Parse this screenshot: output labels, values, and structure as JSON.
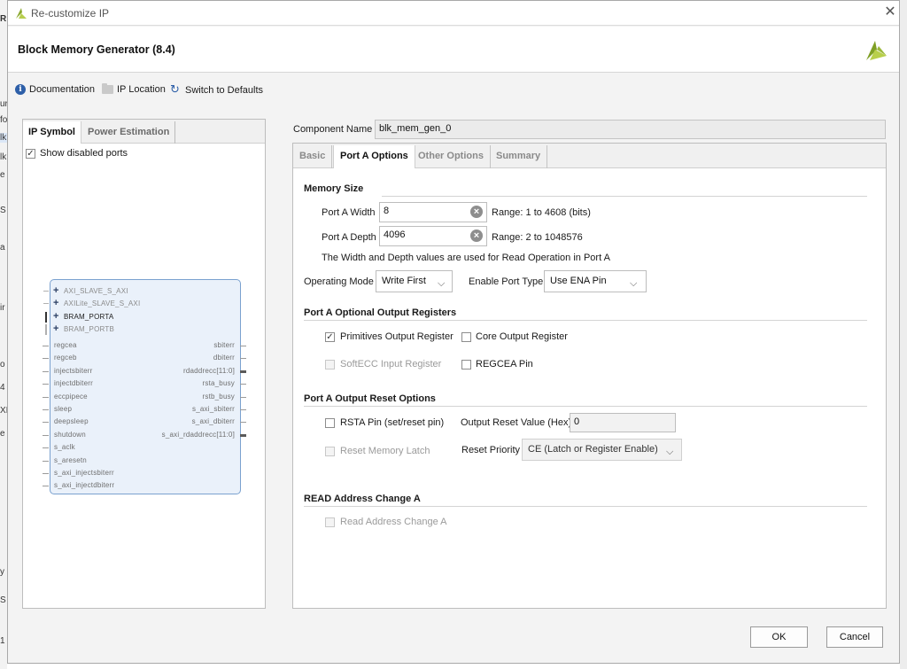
{
  "window": {
    "title": "Re-customize IP"
  },
  "header": {
    "title": "Block Memory Generator (8.4)"
  },
  "toolbar": {
    "documentation": "Documentation",
    "ip_location": "IP Location",
    "switch_defaults": "Switch to Defaults"
  },
  "left_panel": {
    "tabs": [
      "IP Symbol",
      "Power Estimation"
    ],
    "show_disabled_ports": {
      "label": "Show disabled ports",
      "checked": true
    },
    "buses": [
      "AXI_SLAVE_S_AXI",
      "AXILite_SLAVE_S_AXI",
      "BRAM_PORTA",
      "BRAM_PORTB"
    ],
    "left_ports": [
      "regcea",
      "regceb",
      "injectsbiterr",
      "injectdbiterr",
      "eccpipece",
      "sleep",
      "deepsleep",
      "shutdown",
      "s_aclk",
      "s_aresetn",
      "s_axi_injectsbiterr",
      "s_axi_injectdbiterr"
    ],
    "right_ports": [
      "sbiterr",
      "dbiterr",
      "rdaddrecc[11:0]",
      "rsta_busy",
      "rstb_busy",
      "s_axi_sbiterr",
      "s_axi_dbiterr",
      "s_axi_rdaddrecc[11:0]"
    ]
  },
  "component": {
    "label": "Component Name",
    "value": "blk_mem_gen_0"
  },
  "tabs": [
    "Basic",
    "Port A Options",
    "Other Options",
    "Summary"
  ],
  "memory_size": {
    "title": "Memory Size",
    "width_label": "Port A Width",
    "width_value": "8",
    "width_range": "Range: 1 to 4608 (bits)",
    "depth_label": "Port A Depth",
    "depth_value": "4096",
    "depth_range": "Range: 2 to 1048576",
    "note": "The Width and Depth values are used for Read Operation in Port A",
    "op_mode_label": "Operating Mode",
    "op_mode_value": "Write First",
    "enable_label": "Enable Port Type",
    "enable_value": "Use ENA Pin"
  },
  "output_registers": {
    "title": "Port A Optional Output Registers",
    "primitives": {
      "label": "Primitives Output Register",
      "checked": true
    },
    "core": {
      "label": "Core Output Register",
      "checked": false
    },
    "softecc": {
      "label": "SoftECC Input Register",
      "checked": false,
      "disabled": true
    },
    "regcea": {
      "label": "REGCEA Pin",
      "checked": false
    }
  },
  "reset_options": {
    "title": "Port A Output Reset Options",
    "rsta": {
      "label": "RSTA Pin (set/reset pin)",
      "checked": false
    },
    "reset_value_label": "Output Reset Value (Hex)",
    "reset_value": "0",
    "latch": {
      "label": "Reset Memory Latch",
      "checked": false,
      "disabled": true
    },
    "priority_label": "Reset Priority",
    "priority_value": "CE (Latch or Register Enable)"
  },
  "read_address": {
    "title": "READ Address Change A",
    "item": {
      "label": "Read Address Change A",
      "checked": false,
      "disabled": true
    }
  },
  "buttons": {
    "ok": "OK",
    "cancel": "Cancel"
  },
  "icons": {
    "close": "close-icon",
    "logo": "vivado-logo",
    "info": "info-icon",
    "folder": "folder-icon",
    "refresh": "refresh-icon"
  }
}
